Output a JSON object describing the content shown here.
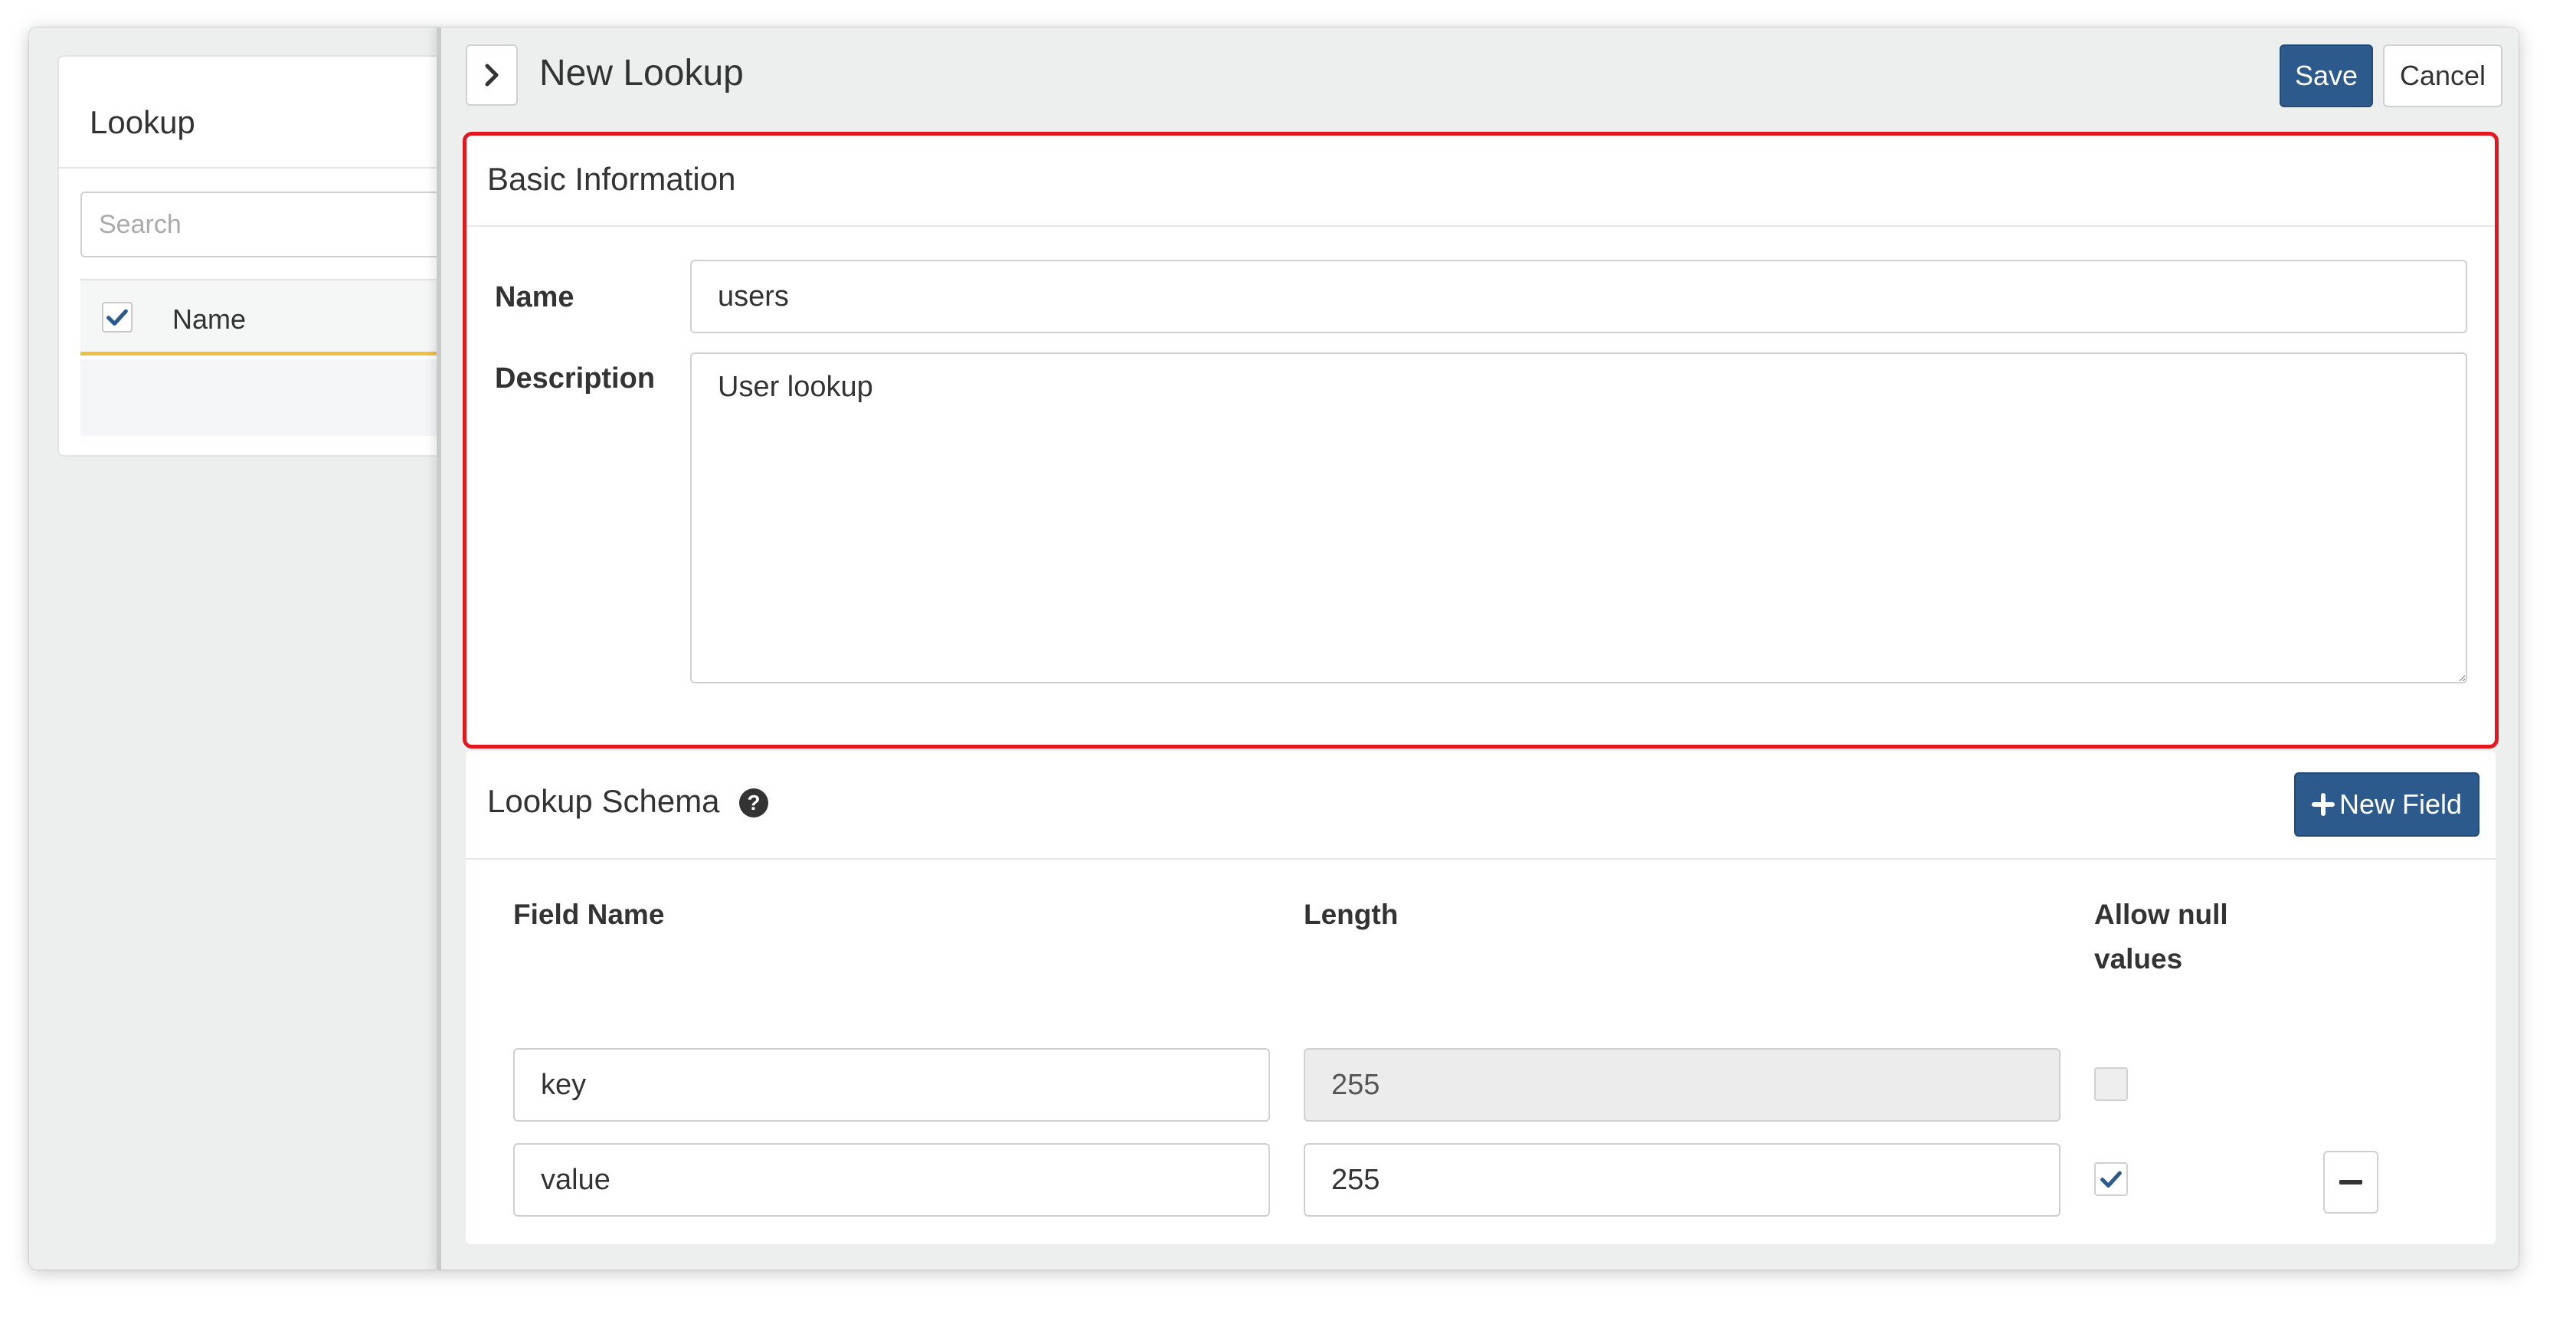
{
  "background_list": {
    "title": "Lookup",
    "search_placeholder": "Search",
    "column_name": "Name",
    "select_all_checked": true
  },
  "header": {
    "title": "New Lookup",
    "save_label": "Save",
    "cancel_label": "Cancel",
    "collapse_icon": "chevron-right-icon"
  },
  "basic_info": {
    "title": "Basic Information",
    "name_label": "Name",
    "name_value": "users",
    "description_label": "Description",
    "description_value": "User lookup",
    "highlight_color": "#e3181e"
  },
  "schema": {
    "title": "Lookup Schema",
    "help_icon": "question-circle-icon",
    "new_field_label": "New Field",
    "new_field_icon": "plus-icon",
    "columns": {
      "field_name": "Field Name",
      "length": "Length",
      "allow_null_line1": "Allow null",
      "allow_null_line2": "values"
    },
    "rows": [
      {
        "field_name": "key",
        "length": "255",
        "length_disabled": true,
        "allow_null": false,
        "allow_null_disabled": true,
        "removable": false
      },
      {
        "field_name": "value",
        "length": "255",
        "length_disabled": false,
        "allow_null": true,
        "allow_null_disabled": false,
        "removable": true
      }
    ]
  },
  "colors": {
    "primary": "#2c5a8c",
    "accent_underline": "#f0c040",
    "check": "#2c5a8c"
  }
}
